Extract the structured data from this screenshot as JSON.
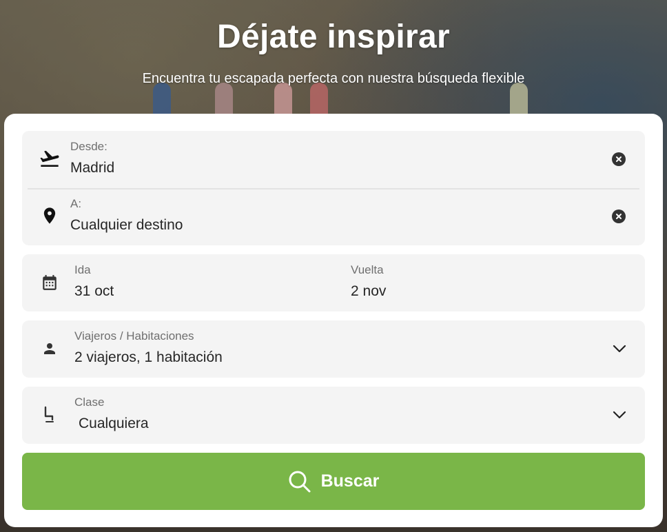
{
  "hero": {
    "title": "Déjate inspirar",
    "subtitle": "Encuentra tu escapada perfecta con nuestra búsqueda flexible"
  },
  "form": {
    "origin": {
      "label": "Desde:",
      "value": "Madrid",
      "icon": "plane-takeoff-icon"
    },
    "destination": {
      "label": "A:",
      "value": "Cualquier destino",
      "icon": "location-pin-icon"
    },
    "dates": {
      "icon": "calendar-icon",
      "depart_label": "Ida",
      "depart_value": "31 oct",
      "return_label": "Vuelta",
      "return_value": "2 nov"
    },
    "travelers": {
      "label": "Viajeros / Habitaciones",
      "value": "2 viajeros, 1 habitación",
      "icon": "person-icon"
    },
    "cabin_class": {
      "label": "Clase",
      "value": "Cualquiera",
      "icon": "seat-icon"
    },
    "search_button": {
      "label": "Buscar",
      "icon": "search-icon",
      "color": "#7ab648"
    }
  }
}
